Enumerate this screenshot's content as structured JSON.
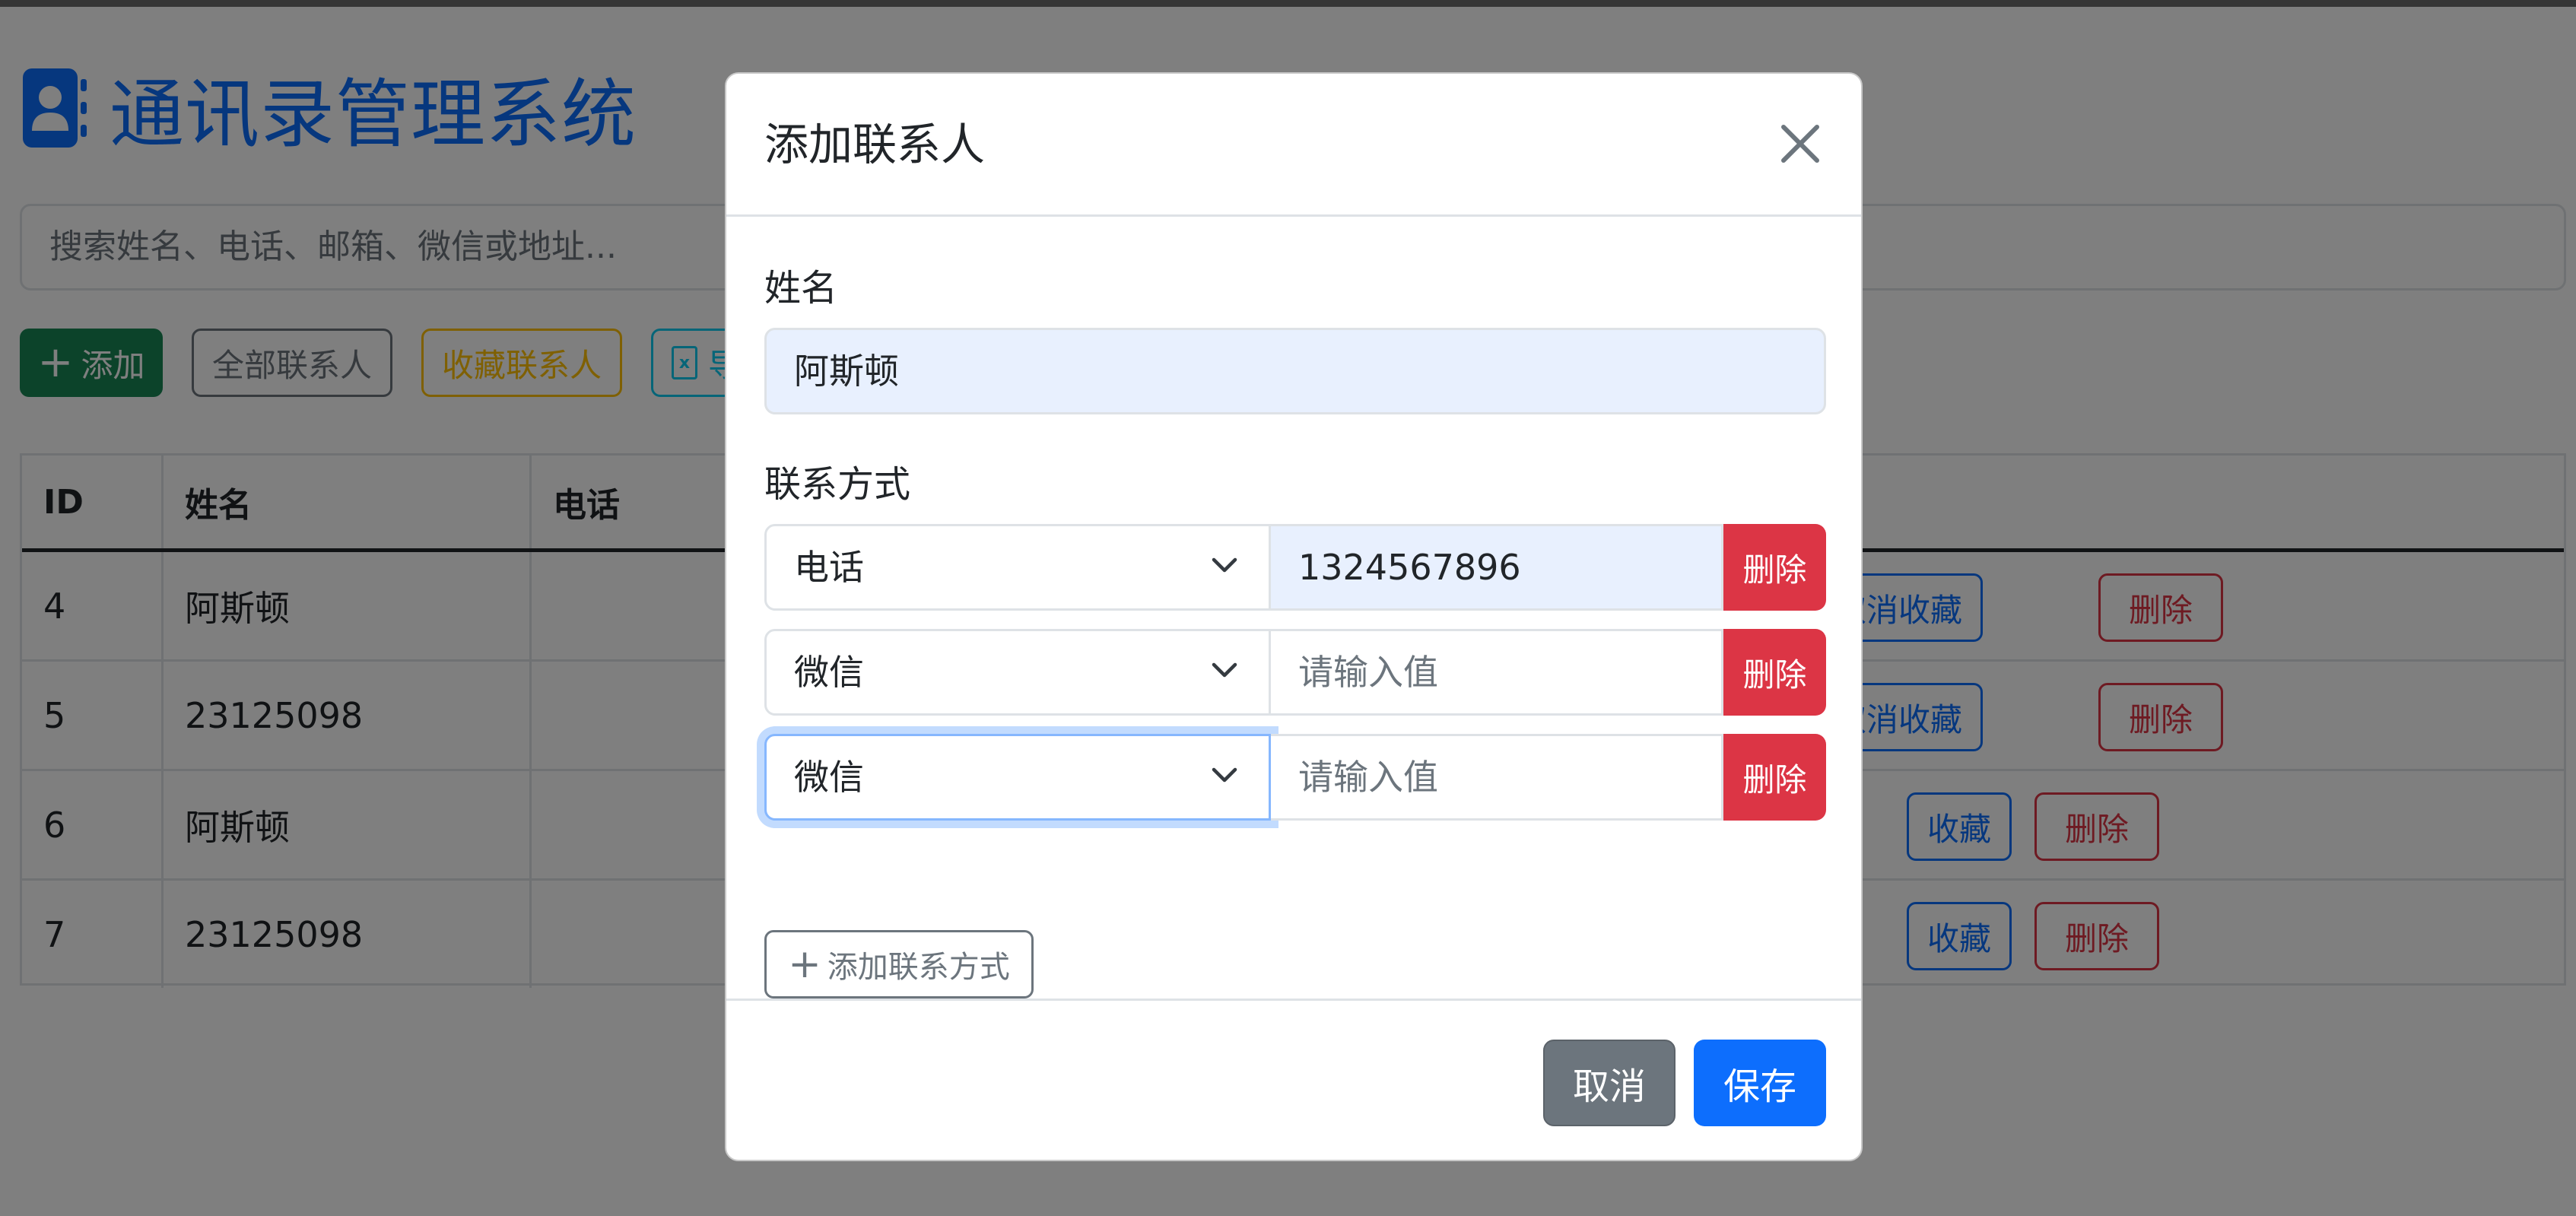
{
  "app": {
    "title": "通讯录管理系统",
    "accent_color": "#0d6efd"
  },
  "search": {
    "placeholder": "搜索姓名、电话、邮箱、微信或地址..."
  },
  "toolbar": {
    "add_label": "添加",
    "all_label": "全部联系人",
    "favorites_label": "收藏联系人",
    "export_label": "导"
  },
  "table": {
    "headers": [
      "ID",
      "姓名",
      "电话"
    ],
    "rows": [
      {
        "id": "4",
        "name": "阿斯顿",
        "fav_label": "取消收藏",
        "delete_label": "删除"
      },
      {
        "id": "5",
        "name": "23125098",
        "fav_label": "取消收藏",
        "delete_label": "删除"
      },
      {
        "id": "6",
        "name": "阿斯顿",
        "fav_label": "收藏",
        "delete_label": "删除"
      },
      {
        "id": "7",
        "name": "23125098",
        "fav_label": "收藏",
        "delete_label": "删除"
      }
    ]
  },
  "modal": {
    "title": "添加联系人",
    "close_icon": "close-icon",
    "name_label": "姓名",
    "name_value": "阿斯顿",
    "contact_label": "联系方式",
    "contacts": [
      {
        "type": "电话",
        "value": "1324567896",
        "placeholder": "请输入值",
        "delete_label": "删除"
      },
      {
        "type": "微信",
        "value": "",
        "placeholder": "请输入值",
        "delete_label": "删除"
      },
      {
        "type": "微信",
        "value": "",
        "placeholder": "请输入值",
        "delete_label": "删除"
      }
    ],
    "add_contact_label": "添加联系方式",
    "cancel_label": "取消",
    "save_label": "保存"
  },
  "colors": {
    "success": "#198754",
    "danger": "#dc3545",
    "warning": "#ffc107",
    "info": "#0dcaf0",
    "secondary": "#6c757d",
    "autofill": "#e8f0fe"
  }
}
